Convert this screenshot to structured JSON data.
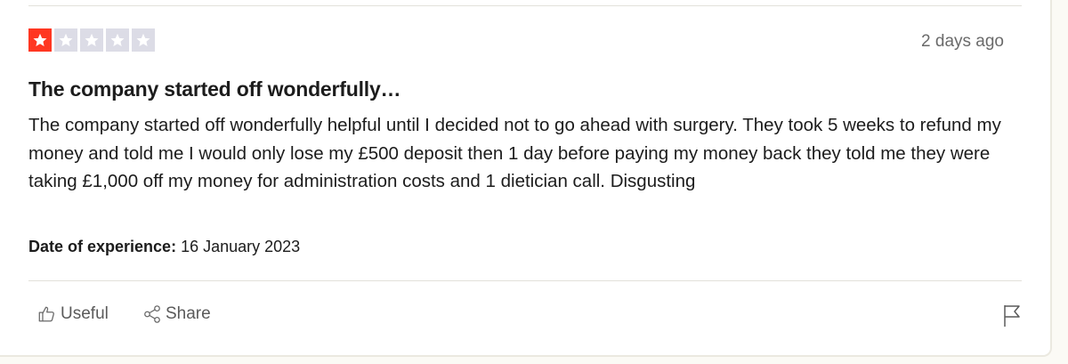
{
  "review": {
    "rating": 1,
    "max_rating": 5,
    "star_color": "#ff3722",
    "empty_star_color": "#dcdce6",
    "posted": "2 days ago",
    "title": "The company started off wonderfully…",
    "body": "The company started off wonderfully helpful until I decided not to go ahead with surgery. They took 5 weeks to refund my money and told me I would only lose my £500 deposit then 1 day before paying my money back they told me they were taking £1,000 off my money for administration costs and 1 dietician call. Disgusting",
    "experience_label": "Date of experience:",
    "experience_date": "16 January 2023"
  },
  "actions": {
    "useful_label": "Useful",
    "useful_icon": "thumbs-up-icon",
    "share_label": "Share",
    "share_icon": "share-icon",
    "report_icon": "flag-icon"
  }
}
